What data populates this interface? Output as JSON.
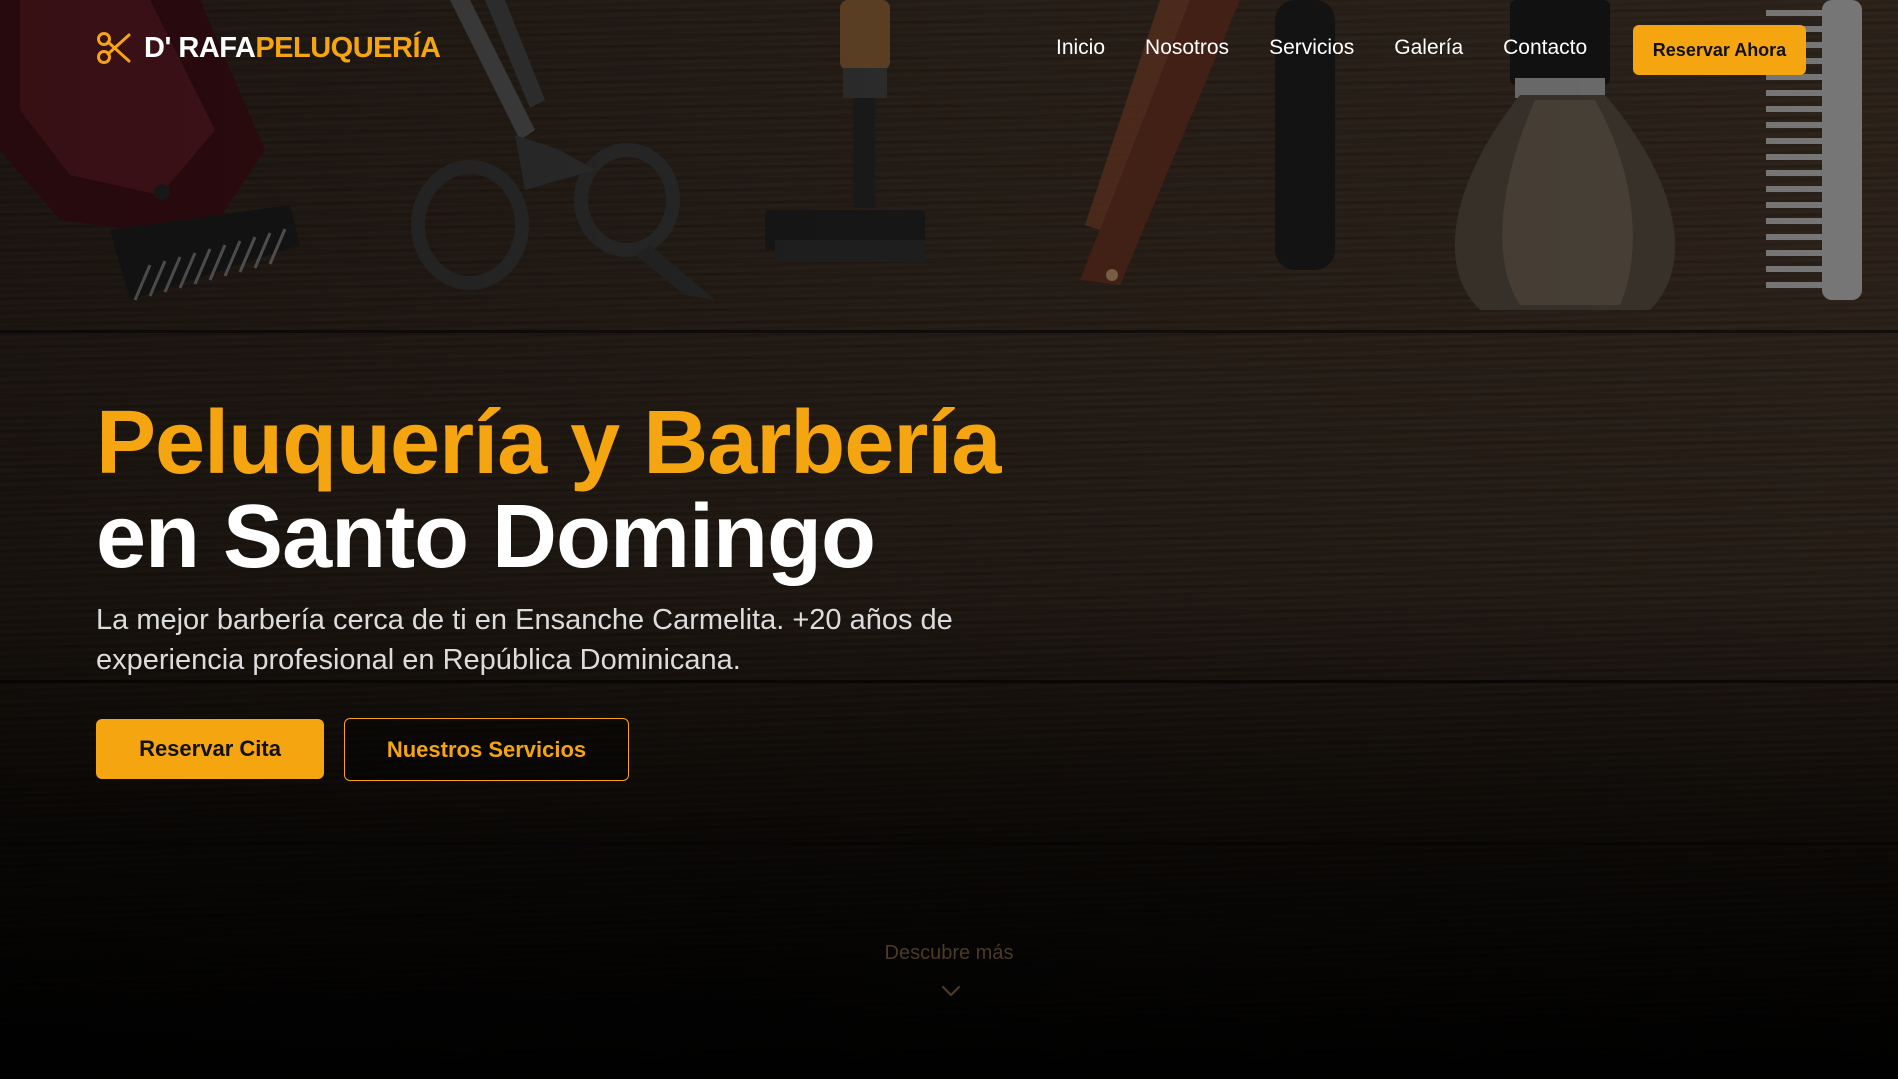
{
  "brand": {
    "name_part1": "D' RAFA",
    "name_part2": "PELUQUERÍA",
    "icon": "scissors-icon",
    "accent_color": "#f5a50f"
  },
  "nav": {
    "items": [
      {
        "label": "Inicio"
      },
      {
        "label": "Nosotros"
      },
      {
        "label": "Servicios"
      },
      {
        "label": "Galería"
      },
      {
        "label": "Contacto"
      }
    ],
    "cta_label": "Reservar Ahora"
  },
  "hero": {
    "title_line1": "Peluquería y Barbería",
    "title_line2": "en Santo Domingo",
    "subtitle": "La mejor barbería cerca de ti en Ensanche Carmelita. +20 años de experiencia profesional en República Dominicana.",
    "primary_button": "Reservar Cita",
    "secondary_button": "Nuestros Servicios",
    "scroll_hint": "Descubre más",
    "scroll_icon": "chevron-down-icon",
    "background": "barber-tools-on-wood"
  }
}
